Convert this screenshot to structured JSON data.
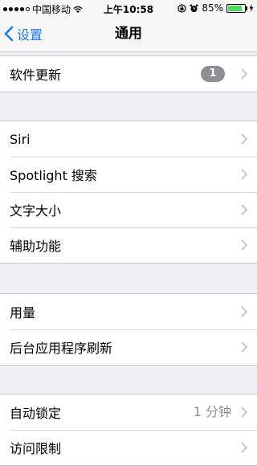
{
  "statusbar": {
    "carrier": "中国移动",
    "time": "上午10:58",
    "battery": "85%",
    "battery_level": 0.85,
    "icons": [
      "signal-dots",
      "wifi-icon",
      "lock-rotation-icon",
      "alarm-icon",
      "battery-icon",
      "charging-icon"
    ]
  },
  "nav": {
    "back_label": "设置",
    "title": "通用"
  },
  "groups": [
    {
      "rows": [
        {
          "label": "软件更新",
          "badge": "1"
        }
      ]
    },
    {
      "rows": [
        {
          "label": "Siri"
        },
        {
          "label": "Spotlight 搜索"
        },
        {
          "label": "文字大小"
        },
        {
          "label": "辅助功能"
        }
      ]
    },
    {
      "rows": [
        {
          "label": "用量"
        },
        {
          "label": "后台应用程序刷新"
        }
      ]
    },
    {
      "rows": [
        {
          "label": "自动锁定",
          "value": "1 分钟"
        },
        {
          "label": "访问限制"
        }
      ]
    }
  ],
  "colors": {
    "accent": "#1a7bf6",
    "background": "#efeff4",
    "badge": "#8e8e93"
  }
}
